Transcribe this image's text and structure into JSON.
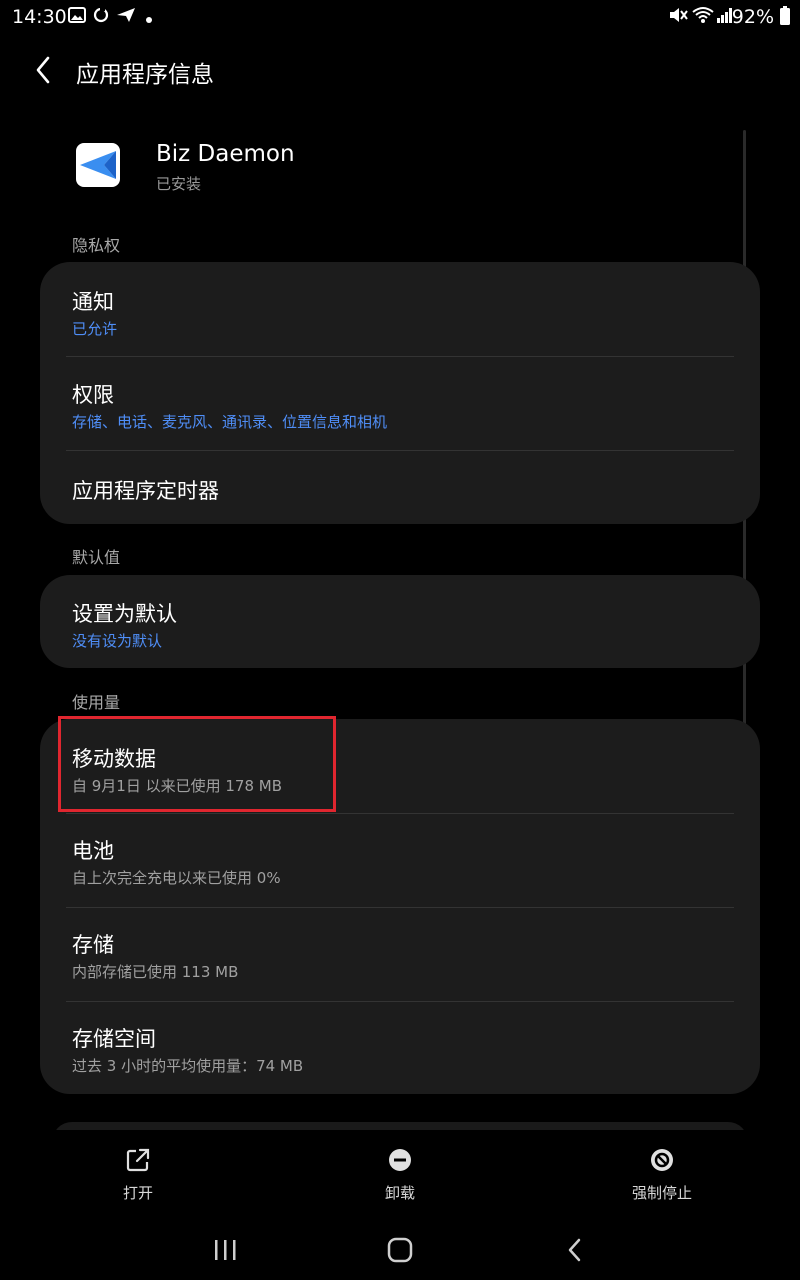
{
  "status_bar": {
    "time": "14:30",
    "battery": "92%",
    "left_icons": [
      "image-icon",
      "sync-icon",
      "send-icon",
      "dot-icon"
    ],
    "right_icons": [
      "mute-icon",
      "wifi-icon",
      "signal-icon",
      "battery-icon"
    ]
  },
  "header": {
    "title": "应用程序信息",
    "back_icon": "chevron-left-icon"
  },
  "app": {
    "name": "Biz Daemon",
    "status": "已安装",
    "icon": "paper-plane-icon"
  },
  "sections": {
    "privacy": {
      "label": "隐私权",
      "items": [
        {
          "title": "通知",
          "subtitle": "已允许"
        },
        {
          "title": "权限",
          "subtitle": "存储、电话、麦克风、通讯录、位置信息和相机"
        },
        {
          "title": "应用程序定时器"
        }
      ]
    },
    "defaults": {
      "label": "默认值",
      "items": [
        {
          "title": "设置为默认",
          "subtitle": "没有设为默认"
        }
      ]
    },
    "usage": {
      "label": "使用量",
      "items": [
        {
          "title": "移动数据",
          "subtitle": "自 9月1日 以来已使用 178 MB"
        },
        {
          "title": "电池",
          "subtitle": "自上次完全充电以来已使用 0%"
        },
        {
          "title": "存储",
          "subtitle": "内部存储已使用 113 MB"
        },
        {
          "title": "存储空间",
          "subtitle": "过去 3 小时的平均使用量：74 MB"
        }
      ]
    }
  },
  "actions": {
    "open": {
      "label": "打开",
      "icon": "open-external-icon"
    },
    "uninstall": {
      "label": "卸载",
      "icon": "minus-circle-icon"
    },
    "force_stop": {
      "label": "强制停止",
      "icon": "block-icon"
    }
  },
  "nav": {
    "recents_icon": "recents-icon",
    "home_icon": "home-icon",
    "back_icon": "back-icon"
  },
  "colors": {
    "background": "#000000",
    "card": "#1c1c1c",
    "accent_blue": "#4f8ef7",
    "highlight": "#e0262f"
  }
}
